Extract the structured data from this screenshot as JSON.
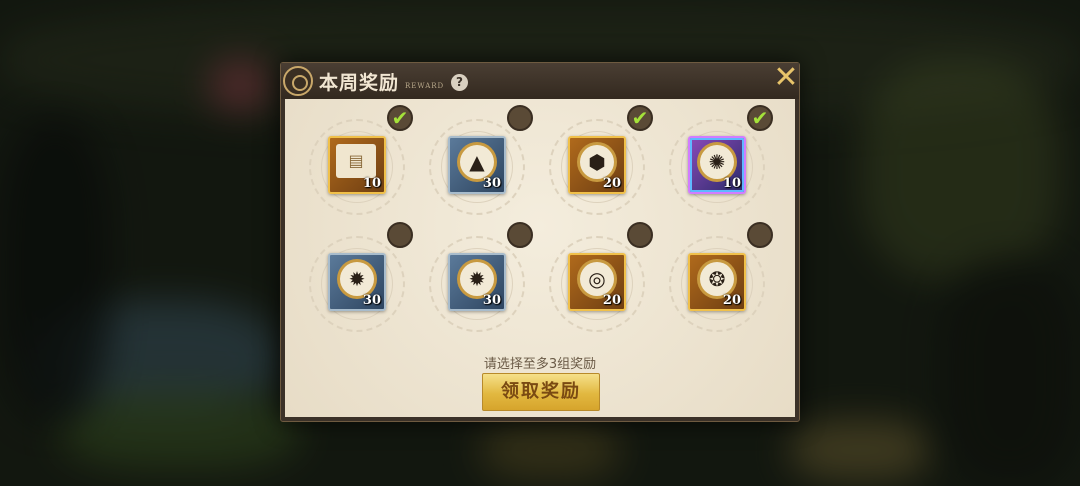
{
  "dialog": {
    "title": "本周奖励",
    "subtitle": "REWARD",
    "help_label": "?",
    "close_label": "✕"
  },
  "rewards": [
    {
      "item": "blueprint-scroll-icon",
      "quantity": "10",
      "rarity": "gold",
      "selected": true,
      "check": "✔"
    },
    {
      "item": "triangle-gear-box-icon",
      "quantity": "30",
      "rarity": "blue",
      "selected": false,
      "check": ""
    },
    {
      "item": "octagon-medallion-box-icon",
      "quantity": "20",
      "rarity": "gold",
      "selected": true,
      "check": "✔"
    },
    {
      "item": "clockwork-core-box-icon",
      "quantity": "10",
      "rarity": "purple",
      "selected": true,
      "check": "✔"
    },
    {
      "item": "sun-gear-box-icon",
      "quantity": "30",
      "rarity": "blue",
      "selected": false,
      "check": ""
    },
    {
      "item": "sun-gear-box-icon",
      "quantity": "30",
      "rarity": "blue",
      "selected": false,
      "check": ""
    },
    {
      "item": "ring-medallion-box-icon",
      "quantity": "20",
      "rarity": "gold",
      "selected": false,
      "check": ""
    },
    {
      "item": "shell-medallion-box-icon",
      "quantity": "20",
      "rarity": "gold",
      "selected": false,
      "check": ""
    }
  ],
  "hint_text": "请选择至多3组奖励",
  "claim_button_label": "领取奖励",
  "colors": {
    "accent_gold": "#e2b840",
    "check_green": "#a4e23a",
    "panel_bg": "#ede4d2"
  }
}
